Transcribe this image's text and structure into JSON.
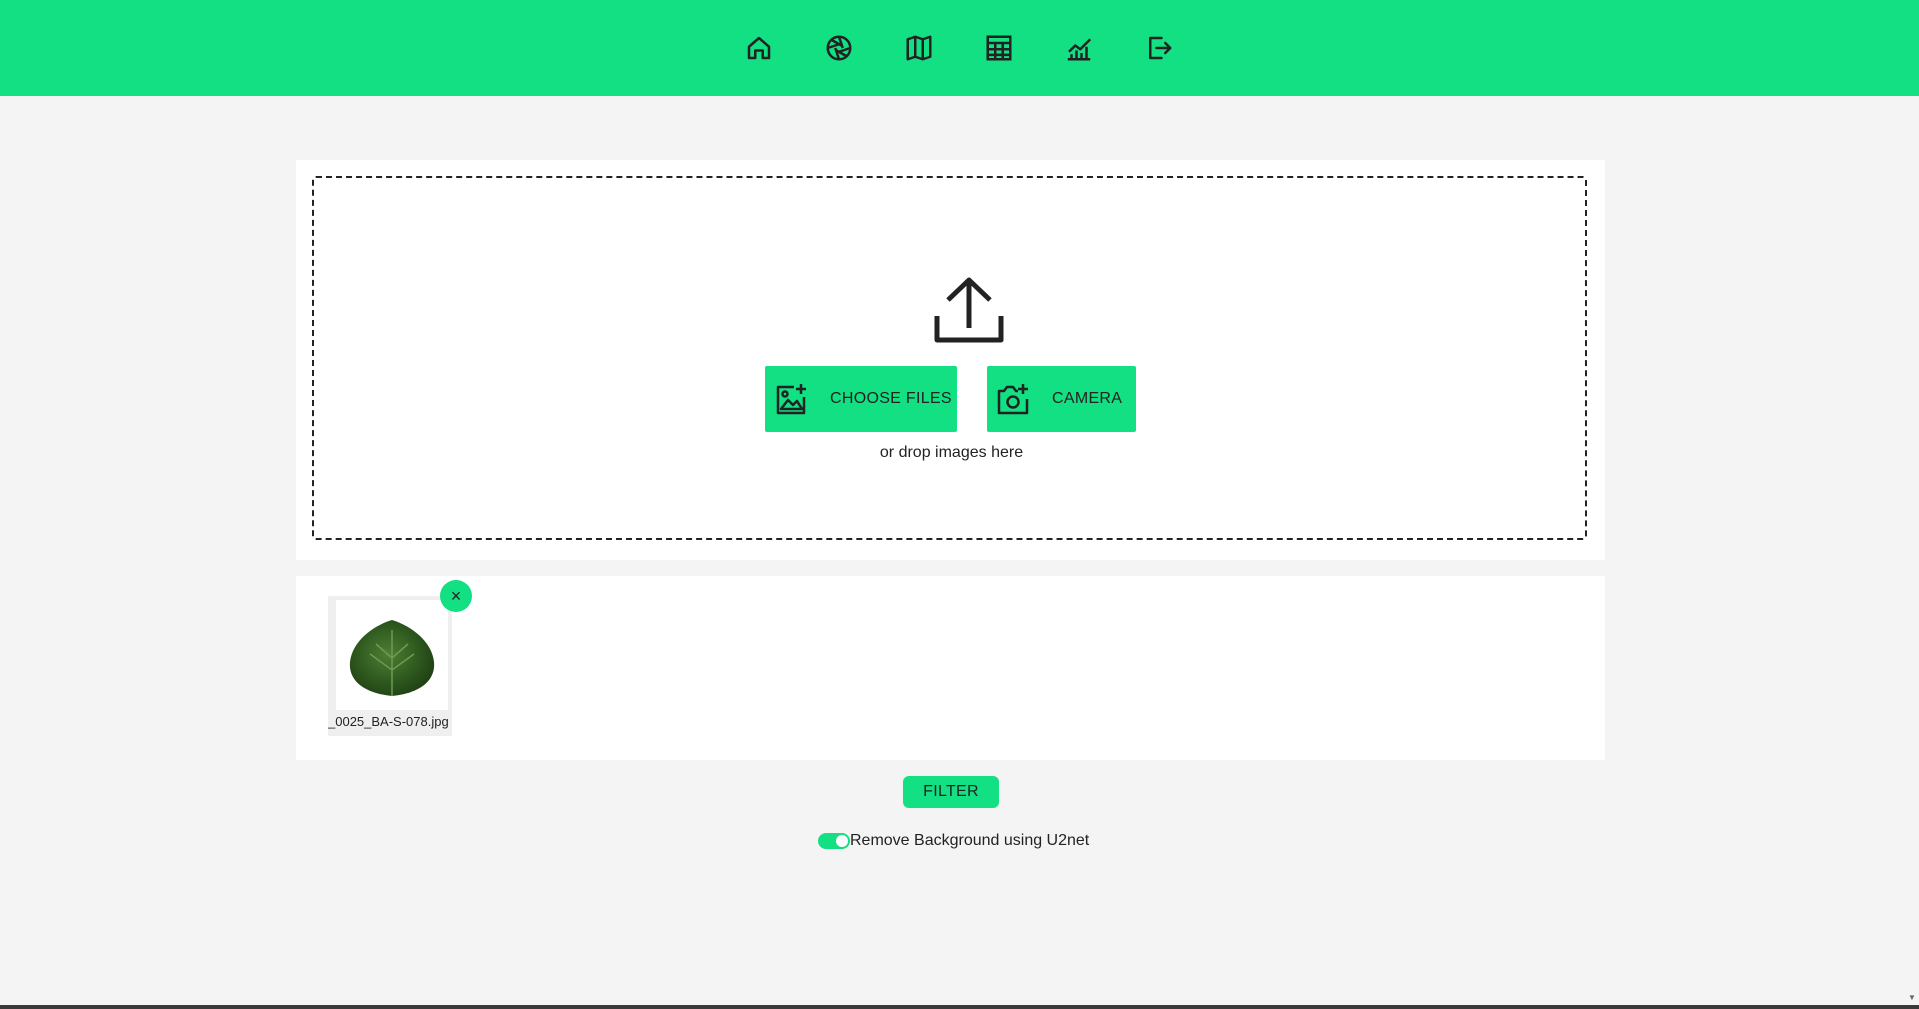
{
  "nav": {
    "items": [
      {
        "name": "home-icon"
      },
      {
        "name": "camera-aperture-icon"
      },
      {
        "name": "map-icon"
      },
      {
        "name": "table-icon"
      },
      {
        "name": "chart-icon"
      },
      {
        "name": "logout-icon"
      }
    ],
    "color": "#13df83"
  },
  "upload": {
    "choose_label": "CHOOSE FILES",
    "camera_label": "CAMERA",
    "drop_hint": "or drop images here"
  },
  "files": [
    {
      "name": "_0025_BA-S-078.jpg",
      "remove_label": "×"
    }
  ],
  "filter_label": "FILTER",
  "bg_removal": {
    "label": "Remove Background using U2net",
    "enabled": true
  }
}
